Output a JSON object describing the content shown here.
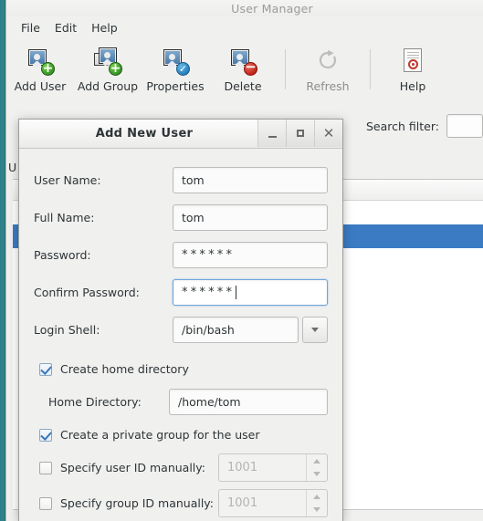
{
  "desktop": {
    "background_color": "#2e7d86"
  },
  "main_window": {
    "title": "User Manager",
    "title_color": "#9b9b99",
    "menubar": [
      {
        "label": "File",
        "name": "menu-file"
      },
      {
        "label": "Edit",
        "name": "menu-edit"
      },
      {
        "label": "Help",
        "name": "menu-help"
      }
    ],
    "toolbar": [
      {
        "label": "Add User",
        "icon": "add-user-icon",
        "name": "toolbar-add-user",
        "disabled": false
      },
      {
        "label": "Add Group",
        "icon": "add-group-icon",
        "name": "toolbar-add-group",
        "disabled": false
      },
      {
        "label": "Properties",
        "icon": "properties-icon",
        "name": "toolbar-properties",
        "disabled": false
      },
      {
        "label": "Delete",
        "icon": "delete-icon",
        "name": "toolbar-delete",
        "disabled": false
      },
      {
        "label": "Refresh",
        "icon": "refresh-icon",
        "name": "toolbar-refresh",
        "disabled": true
      },
      {
        "label": "Help",
        "icon": "help-icon",
        "name": "toolbar-help",
        "disabled": false
      }
    ],
    "filter": {
      "label": "Search filter:",
      "value": "",
      "placeholder": ""
    },
    "list": {
      "selected_row_color": "#3a7bc4"
    },
    "partial_left_label": "U"
  },
  "dialog": {
    "title": "Add New User",
    "window_buttons": {
      "minimize": "minimize-icon",
      "maximize": "maximize-icon",
      "close": "close-icon"
    },
    "fields": {
      "user_name": {
        "label": "User Name:",
        "value": "tom",
        "focused": false
      },
      "full_name": {
        "label": "Full Name:",
        "value": "tom",
        "focused": false
      },
      "password": {
        "label": "Password:",
        "value": "••••••",
        "masked": "******",
        "focused": false
      },
      "confirm_password": {
        "label": "Confirm Password:",
        "value": "••••••",
        "masked": "******",
        "focused": true
      },
      "login_shell": {
        "label": "Login Shell:",
        "value": "/bin/bash"
      },
      "home_directory": {
        "label": "Home Directory:",
        "value": "/home/tom"
      }
    },
    "checkboxes": {
      "create_home": {
        "label": "Create home directory",
        "checked": true
      },
      "private_group": {
        "label": "Create a private group for the user",
        "checked": true
      },
      "specify_uid": {
        "label": "Specify user ID manually:",
        "checked": false
      },
      "specify_gid": {
        "label": "Specify group ID manually:",
        "checked": false
      }
    },
    "spinners": {
      "uid": {
        "value": "1001",
        "enabled": false
      },
      "gid": {
        "value": "1001",
        "enabled": false
      }
    }
  }
}
